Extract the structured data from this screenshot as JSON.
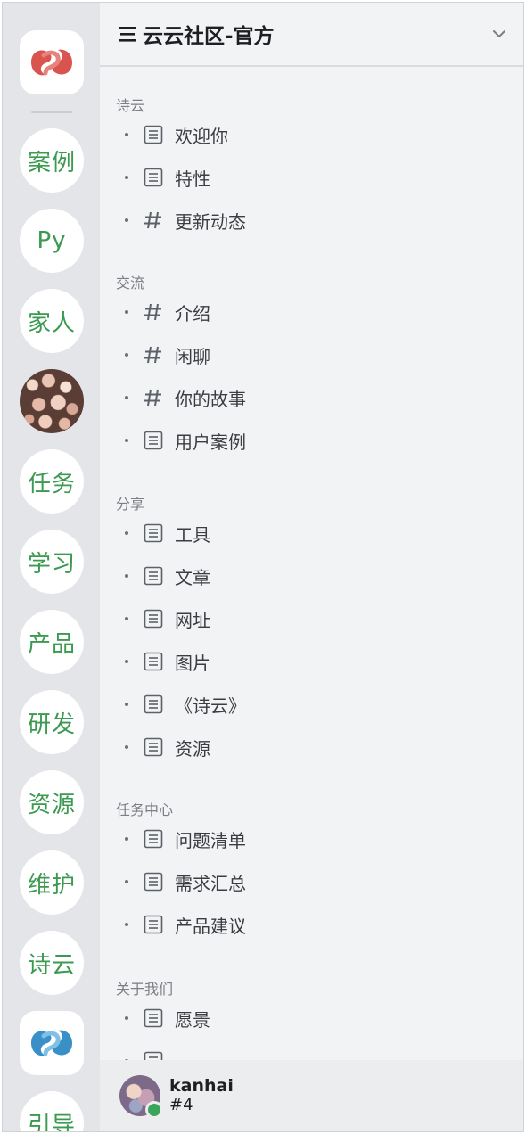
{
  "server_rail": {
    "items": [
      {
        "label": "案例"
      },
      {
        "label": "Py"
      },
      {
        "label": "家人"
      },
      {
        "label": "任务"
      },
      {
        "label": "学习"
      },
      {
        "label": "产品"
      },
      {
        "label": "研发"
      },
      {
        "label": "资源"
      },
      {
        "label": "维护"
      },
      {
        "label": "诗云"
      },
      {
        "label": "引导"
      }
    ]
  },
  "header": {
    "title": "云云社区-官方"
  },
  "categories": [
    {
      "name": "诗云",
      "channels": [
        {
          "label": "欢迎你",
          "icon": "doc-icon"
        },
        {
          "label": "特性",
          "icon": "doc-icon"
        },
        {
          "label": "更新动态",
          "icon": "hash-icon"
        }
      ]
    },
    {
      "name": "交流",
      "channels": [
        {
          "label": "介绍",
          "icon": "hash-icon"
        },
        {
          "label": "闲聊",
          "icon": "hash-icon"
        },
        {
          "label": "你的故事",
          "icon": "hash-icon"
        },
        {
          "label": "用户案例",
          "icon": "doc-icon"
        }
      ]
    },
    {
      "name": "分享",
      "channels": [
        {
          "label": "工具",
          "icon": "doc-icon"
        },
        {
          "label": "文章",
          "icon": "doc-icon"
        },
        {
          "label": "网址",
          "icon": "doc-icon"
        },
        {
          "label": "图片",
          "icon": "doc-icon"
        },
        {
          "label": "《诗云》",
          "icon": "doc-icon"
        },
        {
          "label": "资源",
          "icon": "doc-icon"
        }
      ]
    },
    {
      "name": "任务中心",
      "channels": [
        {
          "label": "问题清单",
          "icon": "doc-icon"
        },
        {
          "label": "需求汇总",
          "icon": "doc-icon"
        },
        {
          "label": "产品建议",
          "icon": "doc-icon"
        }
      ]
    },
    {
      "name": "关于我们",
      "channels": [
        {
          "label": "愿景",
          "icon": "doc-icon"
        },
        {
          "label": "",
          "icon": "doc-icon"
        }
      ]
    }
  ],
  "user": {
    "name": "kanhai",
    "tag": "#4",
    "status": "online",
    "status_color": "#3ba55c"
  },
  "colors": {
    "accent_green": "#3b9a4f",
    "logo_red": "#d9534f",
    "logo_blue": "#3a8fc7"
  }
}
